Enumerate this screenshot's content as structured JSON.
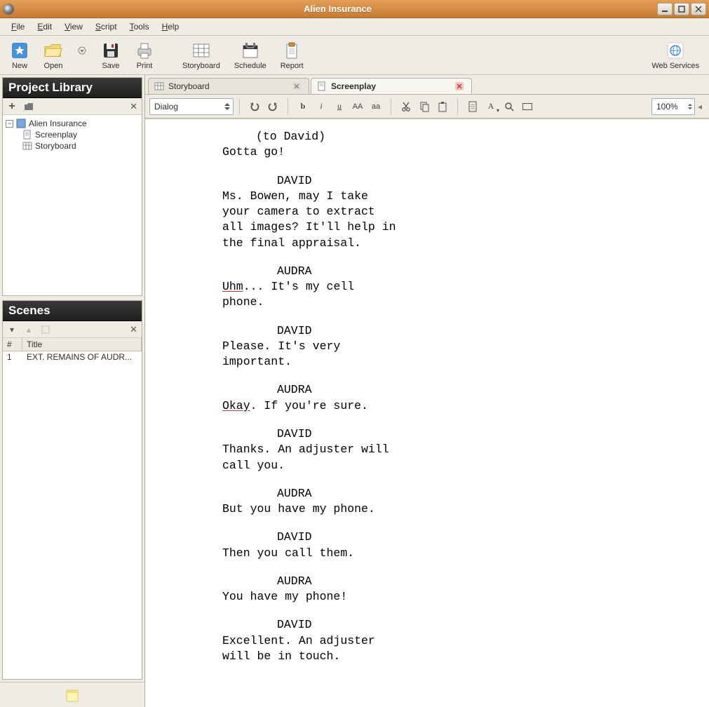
{
  "window": {
    "title": "Alien Insurance"
  },
  "menu": {
    "items": [
      "File",
      "Edit",
      "View",
      "Script",
      "Tools",
      "Help"
    ]
  },
  "toolbar": {
    "new": "New",
    "open": "Open",
    "save": "Save",
    "print": "Print",
    "storyboard": "Storyboard",
    "schedule": "Schedule",
    "report": "Report",
    "webservices": "Web Services"
  },
  "project_library": {
    "title": "Project Library",
    "root": "Alien Insurance",
    "children": [
      "Screenplay",
      "Storyboard"
    ]
  },
  "scenes_panel": {
    "title": "Scenes",
    "headers": {
      "num": "#",
      "title": "Title"
    },
    "rows": [
      {
        "num": "1",
        "title": "EXT. REMAINS OF AUDR..."
      }
    ]
  },
  "tabs": [
    {
      "icon": "storyboard",
      "label": "Storyboard",
      "active": false
    },
    {
      "icon": "screenplay",
      "label": "Screenplay",
      "active": true
    }
  ],
  "editor_toolbar": {
    "style": "Dialog",
    "zoom": "100%"
  },
  "screenplay": {
    "blocks": [
      {
        "type": "paren",
        "text": "(to David)"
      },
      {
        "type": "dialog",
        "text": "Gotta go!"
      },
      {
        "type": "char",
        "text": "DAVID"
      },
      {
        "type": "dialog",
        "text": "Ms. Bowen, may I take"
      },
      {
        "type": "dialog",
        "text": "your camera to extract"
      },
      {
        "type": "dialog",
        "text": "all images? It'll help in"
      },
      {
        "type": "dialog",
        "text": "the final appraisal."
      },
      {
        "type": "char",
        "text": "AUDRA"
      },
      {
        "type": "dialog",
        "html": "<span class='underline'>Uhm</span>... It's my cell"
      },
      {
        "type": "dialog",
        "text": "phone."
      },
      {
        "type": "char",
        "text": "DAVID"
      },
      {
        "type": "dialog",
        "text": "Please. It's very"
      },
      {
        "type": "dialog",
        "text": "important."
      },
      {
        "type": "char",
        "text": "AUDRA"
      },
      {
        "type": "dialog",
        "html": "<span class='underline'>Okay</span>. If you're sure."
      },
      {
        "type": "char",
        "text": "DAVID"
      },
      {
        "type": "dialog",
        "text": "Thanks. An adjuster will"
      },
      {
        "type": "dialog",
        "text": "call you."
      },
      {
        "type": "char",
        "text": "AUDRA"
      },
      {
        "type": "dialog",
        "text": "But you have my phone."
      },
      {
        "type": "char",
        "text": "DAVID"
      },
      {
        "type": "dialog",
        "text": "Then you call them."
      },
      {
        "type": "char",
        "text": "AUDRA"
      },
      {
        "type": "dialog",
        "text": "You have my phone!"
      },
      {
        "type": "char",
        "text": "DAVID"
      },
      {
        "type": "dialog",
        "text": "Excellent. An adjuster"
      },
      {
        "type": "dialog",
        "text": "will be in touch."
      }
    ]
  }
}
